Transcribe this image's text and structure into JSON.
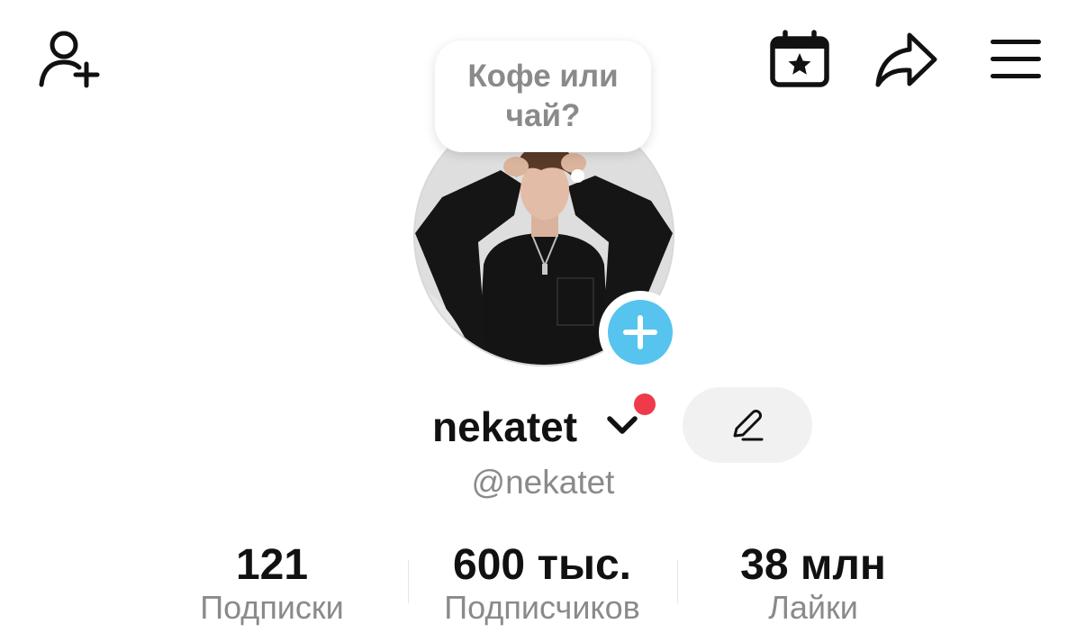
{
  "header": {
    "add_friend_icon": "person-add-icon",
    "calendar_icon": "calendar-star-icon",
    "share_icon": "share-arrow-icon",
    "menu_icon": "hamburger-menu-icon"
  },
  "note": {
    "text": "Кофе или чай?"
  },
  "profile": {
    "avatar_icon": "avatar-photo",
    "add_badge_color": "#56c4ee",
    "username": "nekatet",
    "notification_dot_color": "#ee3a4a",
    "handle": "@nekatet"
  },
  "stats": [
    {
      "value": "121",
      "label": "Подписки"
    },
    {
      "value": "600 тыс.",
      "label": "Подписчиков"
    },
    {
      "value": "38 млн",
      "label": "Лайки"
    }
  ]
}
